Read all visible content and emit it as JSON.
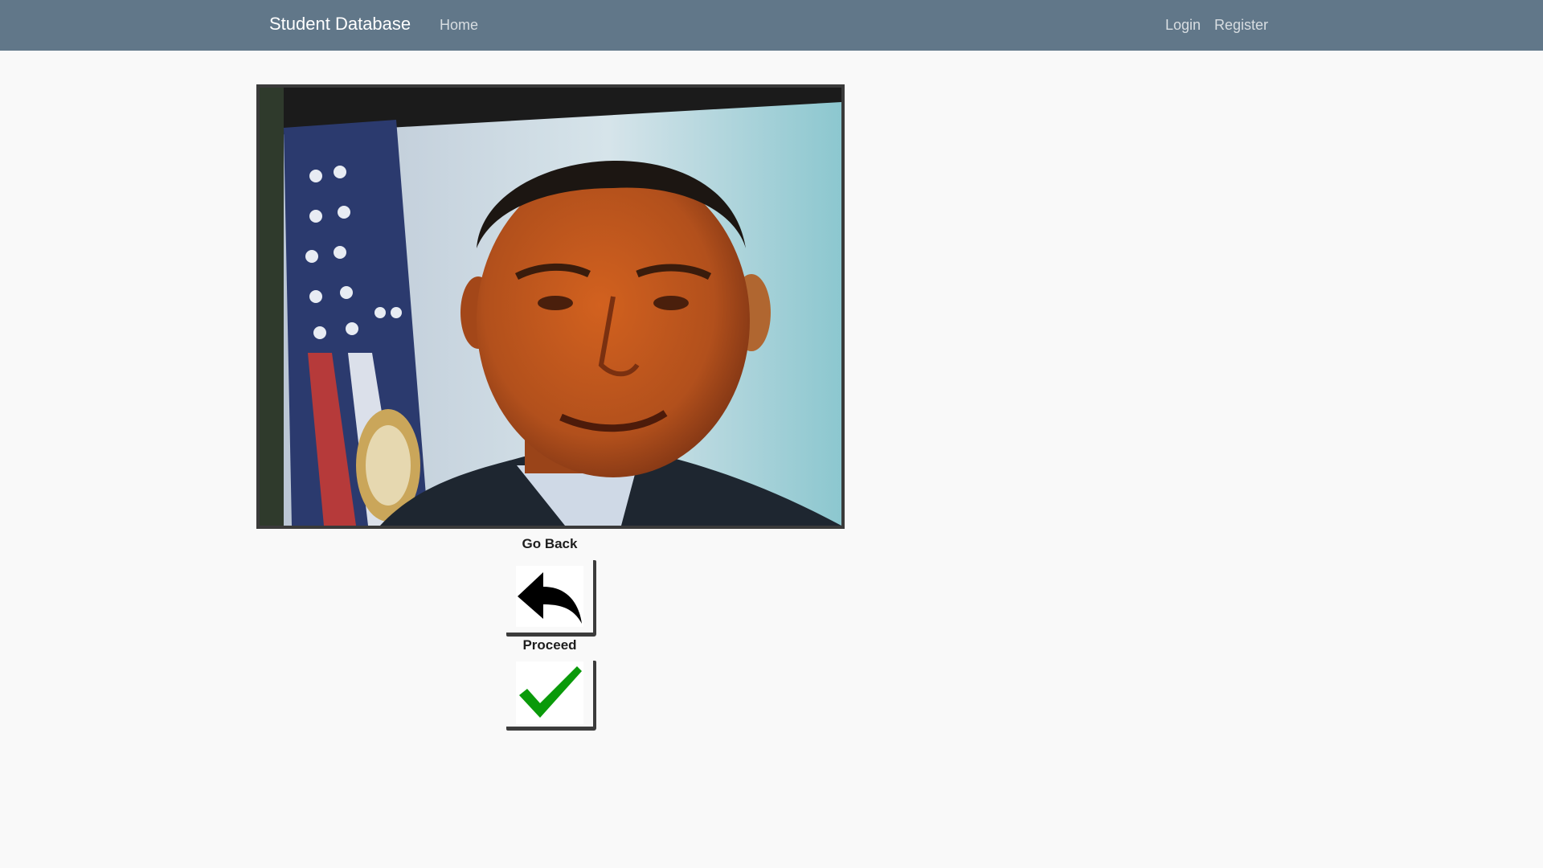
{
  "navbar": {
    "brand": "Student Database",
    "home": "Home",
    "login": "Login",
    "register": "Register",
    "background": "#617789"
  },
  "snapshot": {
    "description_icon": "captured-face-photo"
  },
  "actions": {
    "go_back_label": "Go Back",
    "go_back_icon": "undo-arrow-icon",
    "proceed_label": "Proceed",
    "proceed_icon": "checkmark-icon",
    "checkmark_color": "#0a9a0a"
  }
}
